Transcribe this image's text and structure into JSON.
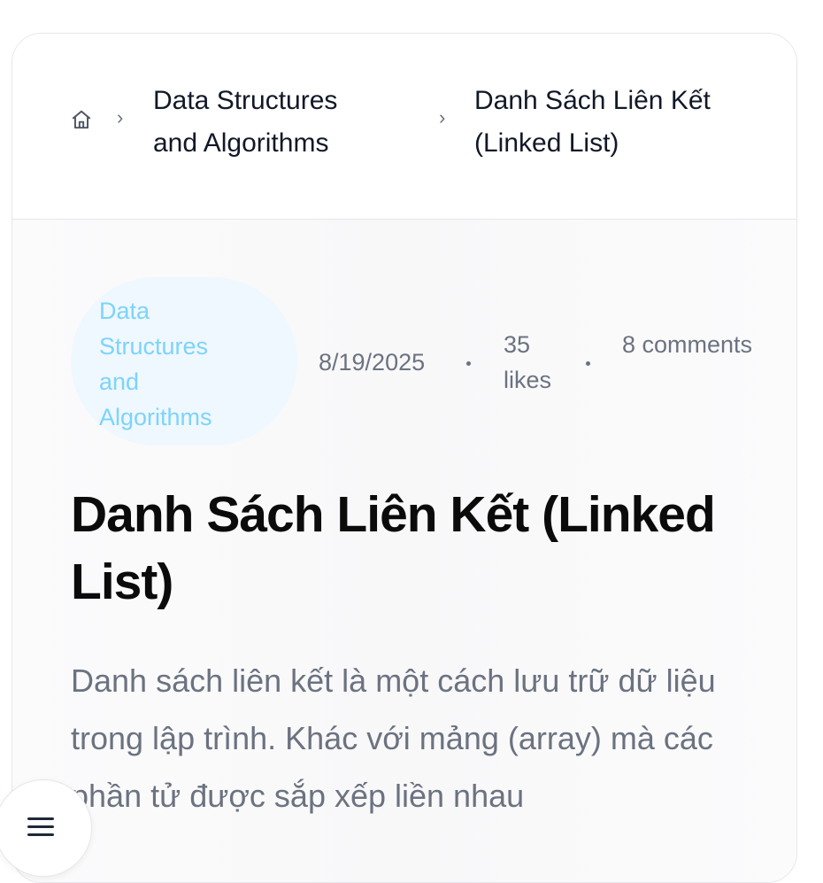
{
  "breadcrumb": {
    "home_icon": "home-icon",
    "separator_icon": "chevron-right-icon",
    "items": [
      {
        "label": "Data Structures and Algorithms"
      },
      {
        "label": "Danh Sách Liên Kết (Linked List)"
      }
    ]
  },
  "post": {
    "category": "Data Structures and Algorithms",
    "date": "8/19/2025",
    "likes": "35 likes",
    "comments": "8 comments",
    "title": "Danh Sách Liên Kết (Linked List)",
    "excerpt": "Danh sách liên kết là một cách lưu trữ dữ liệu trong lập trình. Khác với mảng (array) mà các phần tử được sắp xếp liền nhau"
  },
  "menu_button": {
    "icon": "menu-icon"
  },
  "colors": {
    "category_text": "#7dd3fc",
    "category_bg": "#eff8fe",
    "muted_text": "#6b7280",
    "title_text": "#0b0b0c"
  }
}
